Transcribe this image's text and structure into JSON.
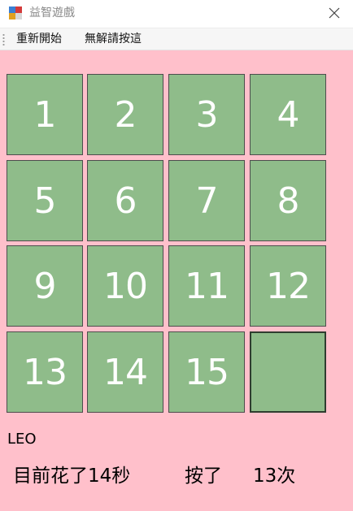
{
  "window": {
    "title": "益智遊戲",
    "icon": "app-icon",
    "close_icon": "close-icon"
  },
  "menu": {
    "restart_label": "重新開始",
    "hint_label": "無解請按這"
  },
  "board": {
    "tiles": [
      "1",
      "2",
      "3",
      "4",
      "5",
      "6",
      "7",
      "8",
      "9",
      "10",
      "11",
      "12",
      "13",
      "14",
      "15",
      ""
    ],
    "tile_color": "#8fbc8a",
    "background_color": "#ffc0cb"
  },
  "status": {
    "player_name": "LEO",
    "time_text": "目前花了14秒",
    "press_text": "按了",
    "count_text": "13次"
  }
}
